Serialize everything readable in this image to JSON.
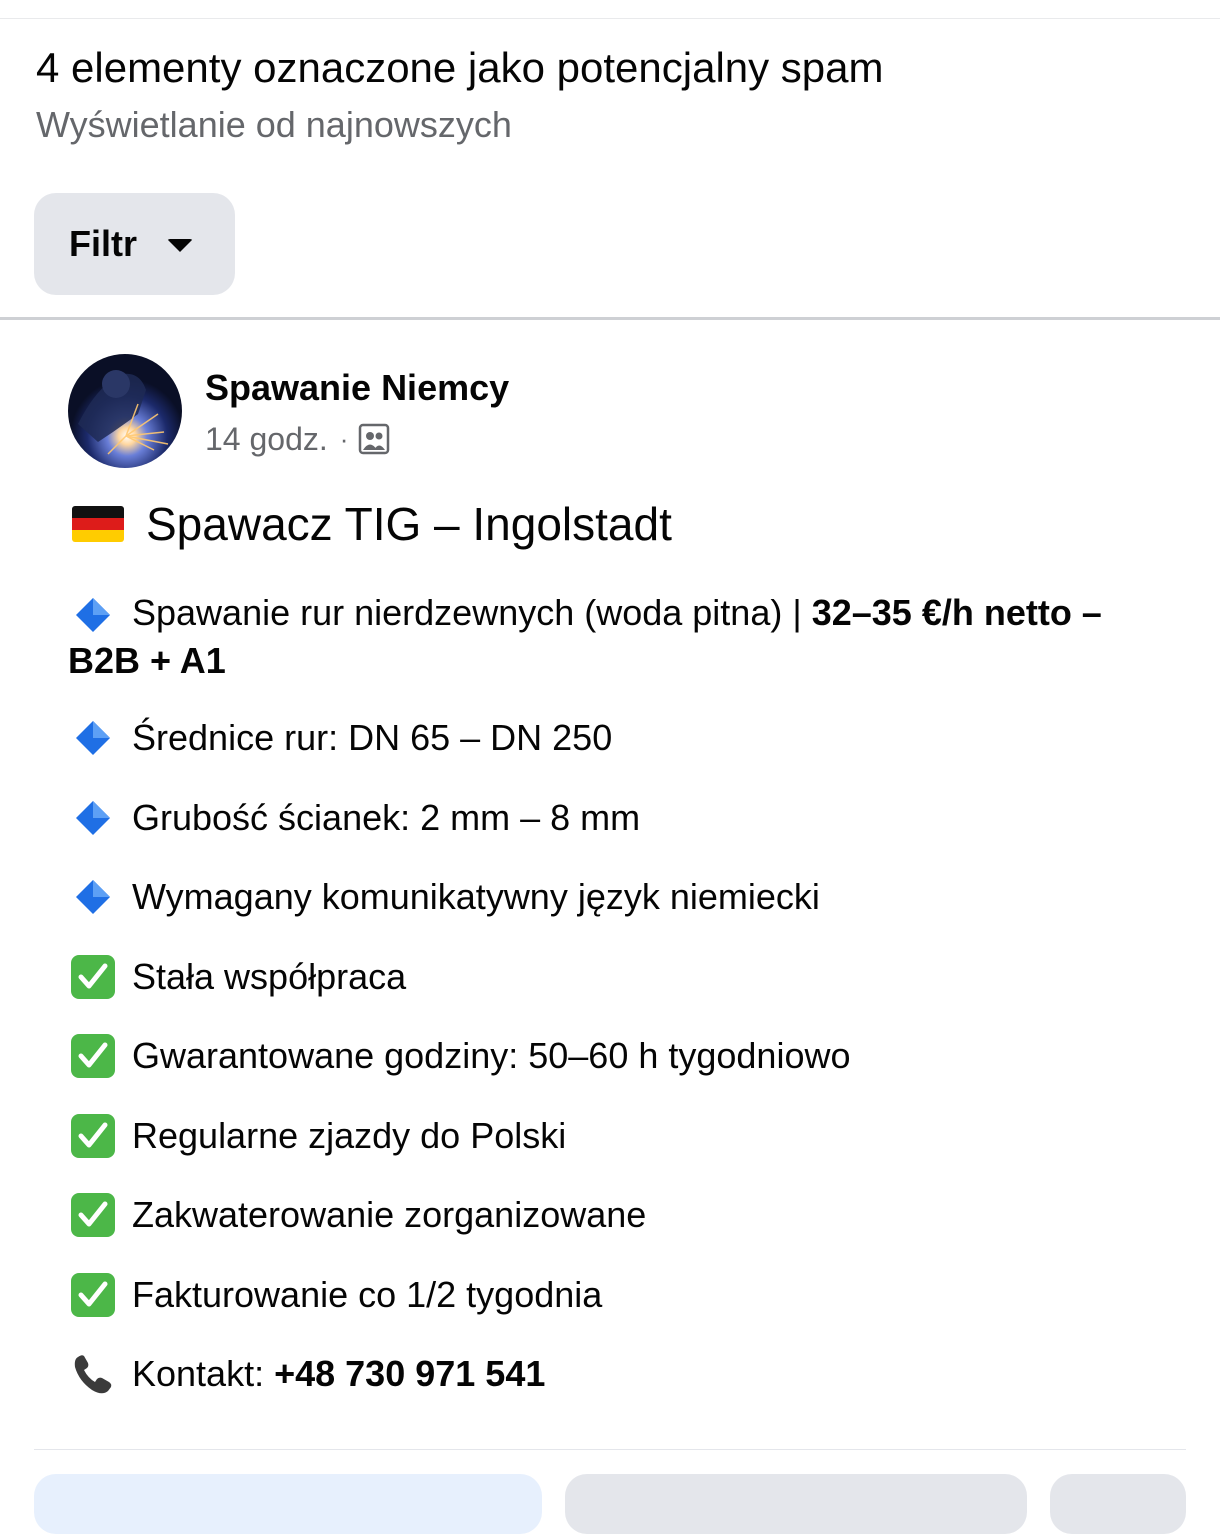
{
  "header": {
    "title": "4 elementy oznaczone jako potencjalny spam",
    "subtitle": "Wyświetlanie od najnowszych",
    "filter_label": "Filtr"
  },
  "post": {
    "author": "Spawanie Niemcy",
    "time": "14 godz.",
    "separator": "·",
    "audience_icon": "group-icon",
    "title": "Spawacz TIG – Ingolstadt",
    "line1_text": "Spawanie rur nierdzewnych (woda pitna) | ",
    "line1_bold": "32–35 €/h netto – B2B + A1",
    "line2": "Średnice rur: DN 65 – DN 250",
    "line3": "Grubość ścianek: 2 mm – 8 mm",
    "line4": "Wymagany komunikatywny język niemiecki",
    "check1": "Stała współpraca",
    "check2": "Gwarantowane godziny: 50–60 h tygodniowo",
    "check3": "Regularne zjazdy do Polski",
    "check4": "Zakwaterowanie zorganizowane",
    "check5": "Fakturowanie co 1/2 tygodnia",
    "contact_label": "Kontakt: ",
    "contact_phone": "+48 730 971 541"
  },
  "colors": {
    "secondary_text": "#65676b",
    "button_bg": "#e4e6eb",
    "primary_action_bg": "#e7f0fd",
    "check_green": "#4cb748",
    "diamond_blue": "#1f6fe5"
  }
}
